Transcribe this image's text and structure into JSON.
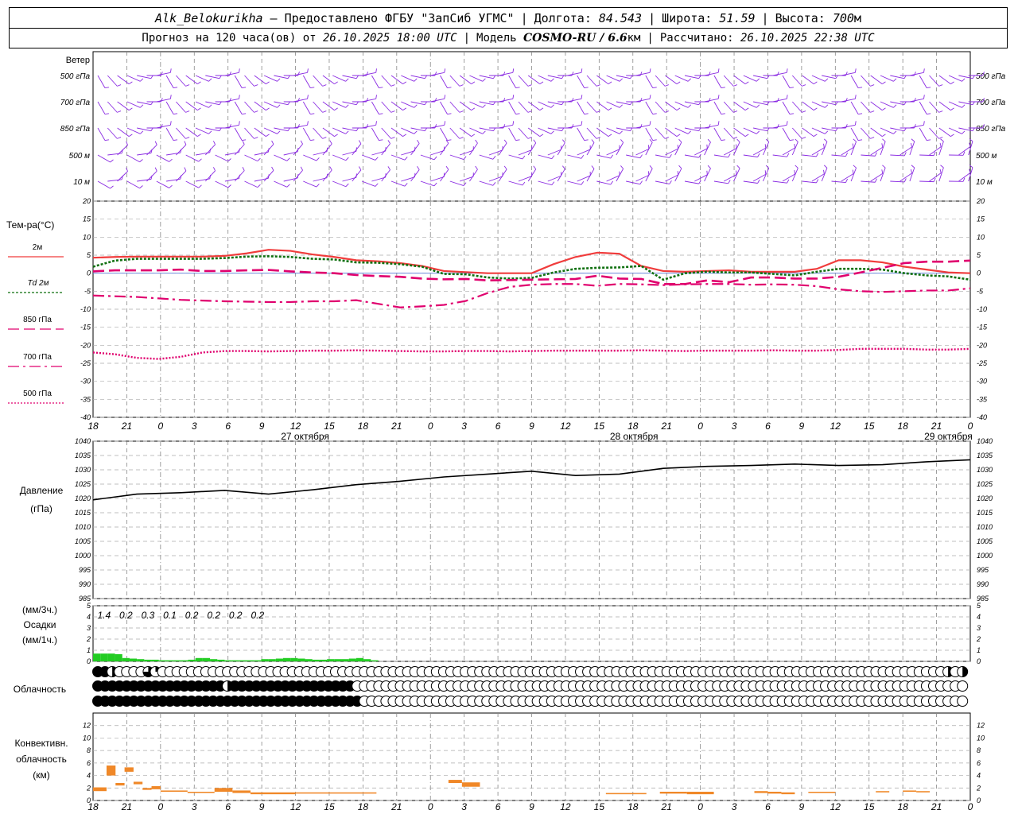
{
  "header": {
    "station": "Alk_Belokurikha",
    "provided": "– Предоставлено ФГБУ \"ЗапСиб УГМС\"",
    "lon_label": "Долгота:",
    "lon": "84.543",
    "lat_label": "Широта:",
    "lat": "51.59",
    "alt_label": "Высота:",
    "alt": "700",
    "alt_unit": "м",
    "fc_label": "Прогноз на 120 часа(ов) от",
    "fc_date": "26.10.2025 18:00 UTC",
    "model_label": "Модель",
    "model": "COSMO-RU / 6.6",
    "model_unit": "км",
    "calc_label": "Рассчитано:",
    "calc_date": "26.10.2025 22:38 UTC"
  },
  "time_ticks": [
    "18",
    "21",
    "0",
    "3",
    "6",
    "9",
    "12",
    "15",
    "18",
    "21",
    "0",
    "3",
    "6",
    "9",
    "12",
    "15",
    "18",
    "21",
    "0",
    "3",
    "6",
    "9",
    "12",
    "15",
    "18",
    "21",
    "0"
  ],
  "date_labels": [
    "27 октября",
    "28 октября",
    "29 октября"
  ],
  "colors": {
    "t2m": "#f03c3c",
    "td": "#107010",
    "t850": "#e0006e",
    "t700": "#e0006e",
    "t500": "#e0006e",
    "wind": "#8a2be2",
    "precip": "#22cc22",
    "conv": "#f08828"
  },
  "chart_data": [
    {
      "type": "wind_barbs",
      "title": "Ветер",
      "levels": [
        "500 гПа",
        "700 гПа",
        "850 гПа",
        "500 м",
        "10  м"
      ]
    },
    {
      "type": "line",
      "title": "Тем-ра(°C)",
      "ylim": [
        -40,
        20
      ],
      "yticks": [
        20,
        15,
        10,
        5,
        0,
        -5,
        -10,
        -15,
        -20,
        -25,
        -30,
        -35,
        -40
      ],
      "x": [
        0,
        3,
        6,
        9,
        12,
        15,
        18,
        21,
        24,
        27,
        30,
        33,
        36,
        39,
        42,
        45,
        48,
        51,
        54,
        57,
        60,
        63,
        66,
        69,
        72,
        75,
        78,
        81,
        84,
        87,
        90,
        93,
        96,
        99,
        102,
        105,
        108,
        111,
        114,
        117,
        120
      ],
      "series": [
        {
          "name": "2м",
          "values": [
            4.3,
            4.5,
            4.6,
            4.6,
            4.6,
            4.6,
            4.8,
            5.5,
            6.5,
            6.2,
            5.2,
            4.5,
            3.6,
            3.3,
            2.8,
            2.0,
            0.6,
            0.3,
            0,
            0,
            0,
            2.5,
            4.5,
            5.7,
            5.4,
            2.0,
            0.6,
            0.4,
            0.6,
            0.8,
            0.4,
            0.4,
            0.4,
            1.2,
            3.6,
            3.6,
            3.0,
            1.8,
            1.0,
            0.2,
            0
          ]
        },
        {
          "name": "Td 2м",
          "values": [
            1.8,
            3.5,
            4.0,
            4.0,
            4.0,
            4.0,
            4.2,
            4.6,
            4.7,
            4.5,
            4.0,
            3.8,
            3.0,
            2.9,
            2.5,
            1.8,
            -0.2,
            -0.3,
            -1.2,
            -1.5,
            -1.3,
            0.2,
            1.2,
            1.5,
            1.6,
            2.0,
            -1.8,
            0,
            0.4,
            0.2,
            0.2,
            -0.2,
            -0.6,
            0.4,
            1.2,
            1.2,
            1.0,
            0,
            -0.6,
            -0.9,
            -1.8
          ]
        },
        {
          "name": "850 гПа",
          "values": [
            0.5,
            0.8,
            0.8,
            0.8,
            1.0,
            0.6,
            0.6,
            0.8,
            0.9,
            0.5,
            0.2,
            0,
            -0.5,
            -0.8,
            -1.0,
            -1.5,
            -1.7,
            -1.6,
            -2.0,
            -1.9,
            -1.8,
            -1.7,
            -1.6,
            -0.7,
            -1.5,
            -1.6,
            -3.0,
            -3.0,
            -2.0,
            -2.5,
            -1.2,
            -1.2,
            -1.5,
            -1.5,
            -1.0,
            0.2,
            1.5,
            2.8,
            3.2,
            3.2,
            3.5
          ]
        },
        {
          "name": "700 гПа",
          "values": [
            -6.2,
            -6.4,
            -6.6,
            -7.0,
            -7.4,
            -7.6,
            -7.8,
            -7.9,
            -8.0,
            -8.0,
            -7.8,
            -7.8,
            -7.5,
            -8.5,
            -9.5,
            -9.2,
            -8.8,
            -7.7,
            -5.5,
            -3.8,
            -3.2,
            -3.0,
            -3.0,
            -3.5,
            -3.0,
            -3.1,
            -3.3,
            -3.1,
            -3.0,
            -3.0,
            -3.2,
            -3.1,
            -3.2,
            -3.6,
            -4.5,
            -5.0,
            -5.2,
            -5.0,
            -4.8,
            -4.8,
            -4.2
          ]
        },
        {
          "name": "500 гПа",
          "values": [
            -22,
            -22.5,
            -23.5,
            -23.8,
            -23.2,
            -22,
            -21.6,
            -21.6,
            -21.7,
            -21.6,
            -21.5,
            -21.5,
            -21.4,
            -21.5,
            -21.6,
            -21.7,
            -21.7,
            -21.6,
            -21.6,
            -21.7,
            -21.6,
            -21.5,
            -21.5,
            -21.5,
            -21.5,
            -21.4,
            -21.5,
            -21.6,
            -21.5,
            -21.5,
            -21.5,
            -21.4,
            -21.5,
            -21.5,
            -21.3,
            -21,
            -21,
            -21,
            -21.2,
            -21.2,
            -21
          ]
        }
      ]
    },
    {
      "type": "line",
      "title": "Давление",
      "ylabel": "(гПа)",
      "ylim": [
        985,
        1040
      ],
      "yticks": [
        1040,
        1035,
        1030,
        1025,
        1020,
        1015,
        1010,
        1005,
        1000,
        995,
        990,
        985
      ],
      "x": [
        0,
        6,
        12,
        18,
        24,
        30,
        36,
        42,
        48,
        54,
        60,
        66,
        72,
        78,
        84,
        90,
        96,
        102,
        108,
        114,
        120
      ],
      "series": [
        {
          "name": "Давление",
          "values": [
            1019.5,
            1021.5,
            1022,
            1022.8,
            1021.5,
            1023,
            1024.8,
            1026,
            1027.5,
            1028.5,
            1029.5,
            1028,
            1028.5,
            1030.5,
            1031.2,
            1031.5,
            1032,
            1031.5,
            1031.8,
            1032.8,
            1033.5
          ]
        }
      ]
    },
    {
      "type": "bar",
      "title": "Осадки",
      "ylabel": "(мм/3ч.)",
      "ylabel2": "(мм/1ч.)",
      "ylim": [
        0,
        5
      ],
      "yticks": [
        5,
        4,
        3,
        2,
        1,
        0
      ],
      "x": [
        0,
        1,
        2,
        3,
        4,
        5,
        6,
        7,
        8,
        9,
        10,
        11,
        12,
        13,
        14,
        15,
        16,
        17,
        18,
        19,
        20,
        21,
        22,
        23,
        24,
        25,
        26,
        27,
        28,
        29,
        30,
        31,
        32,
        33,
        34,
        35,
        36,
        37,
        38
      ],
      "values": [
        0.7,
        0.7,
        0.7,
        0.65,
        0.3,
        0.25,
        0.2,
        0.15,
        0.15,
        0.1,
        0.1,
        0.1,
        0.1,
        0.15,
        0.3,
        0.3,
        0.2,
        0.15,
        0.1,
        0.1,
        0.1,
        0.1,
        0.1,
        0.2,
        0.2,
        0.25,
        0.3,
        0.3,
        0.25,
        0.2,
        0.15,
        0.15,
        0.2,
        0.2,
        0.2,
        0.25,
        0.3,
        0.2,
        0.1
      ],
      "three_hour_totals": [
        {
          "t": 1.5,
          "value": "1.4"
        },
        {
          "t": 4.5,
          "value": "0.2"
        },
        {
          "t": 7.5,
          "value": "0.3"
        },
        {
          "t": 10.5,
          "value": "0.1"
        },
        {
          "t": 13.5,
          "value": "0.2"
        },
        {
          "t": 16.5,
          "value": "0.2"
        },
        {
          "t": 19.5,
          "value": "0.2"
        },
        {
          "t": 22.5,
          "value": "0.2"
        }
      ]
    },
    {
      "type": "cloud_cover",
      "title": "Облачность",
      "rows": [
        [
          4,
          4,
          2,
          0,
          0,
          0,
          0,
          3,
          1,
          0,
          0,
          0,
          0,
          0,
          0,
          0,
          0,
          0,
          0,
          0,
          0,
          0,
          0,
          0,
          0,
          0,
          0,
          0,
          0,
          0,
          0,
          0,
          0,
          0,
          0,
          0,
          0,
          0,
          0,
          0,
          0,
          0,
          0,
          0,
          0,
          0,
          0,
          0,
          0,
          0,
          0,
          0,
          0,
          0,
          0,
          0,
          0,
          0,
          0,
          0,
          0,
          0,
          0,
          0,
          0,
          0,
          0,
          0,
          0,
          0,
          0,
          0,
          0,
          0,
          0,
          0,
          0,
          0,
          0,
          0,
          0,
          0,
          0,
          0,
          0,
          0,
          0,
          0,
          0,
          0,
          0,
          0,
          0,
          0,
          0,
          0,
          0,
          0,
          0,
          0,
          0,
          0,
          0,
          0,
          0,
          0,
          0,
          0,
          0,
          0,
          0,
          0,
          0,
          0,
          0,
          0,
          0,
          0,
          2,
          0,
          2
        ],
        [
          4,
          4,
          4,
          4,
          4,
          4,
          4,
          4,
          4,
          4,
          4,
          4,
          4,
          4,
          4,
          4,
          4,
          4,
          2,
          4,
          4,
          4,
          4,
          4,
          4,
          4,
          4,
          4,
          4,
          4,
          4,
          4,
          4,
          4,
          4,
          4,
          0,
          0,
          0,
          0,
          0,
          0,
          0,
          0,
          0,
          0,
          0,
          0,
          0,
          0,
          0,
          0,
          0,
          0,
          0,
          0,
          0,
          0,
          0,
          0,
          0,
          0,
          0,
          0,
          0,
          0,
          0,
          0,
          0,
          0,
          0,
          0,
          0,
          0,
          0,
          0,
          0,
          0,
          0,
          0,
          0,
          0,
          0,
          0,
          0,
          0,
          0,
          0,
          0,
          0,
          0,
          0,
          0,
          0,
          0,
          0,
          0,
          0,
          0,
          0,
          0,
          0,
          0,
          0,
          0,
          0,
          0,
          0,
          0,
          0,
          0,
          0,
          0,
          0,
          0,
          0,
          0,
          0,
          0,
          0,
          0
        ],
        [
          4,
          4,
          4,
          4,
          4,
          4,
          4,
          4,
          4,
          4,
          4,
          4,
          4,
          4,
          4,
          4,
          4,
          4,
          4,
          4,
          4,
          4,
          4,
          4,
          4,
          4,
          4,
          4,
          4,
          4,
          4,
          4,
          4,
          4,
          4,
          4,
          4,
          0,
          0,
          0,
          0,
          0,
          0,
          0,
          0,
          0,
          0,
          0,
          0,
          0,
          0,
          0,
          0,
          0,
          0,
          0,
          0,
          0,
          0,
          0,
          0,
          0,
          0,
          0,
          0,
          0,
          0,
          0,
          0,
          0,
          0,
          0,
          0,
          0,
          0,
          0,
          0,
          0,
          0,
          0,
          0,
          0,
          0,
          0,
          0,
          0,
          0,
          0,
          0,
          0,
          0,
          0,
          0,
          0,
          0,
          0,
          0,
          0,
          0,
          0,
          0,
          0,
          0,
          0,
          0,
          0,
          0,
          0,
          0,
          0,
          0,
          0,
          0,
          0,
          0,
          0,
          0,
          0,
          0,
          0,
          0
        ]
      ]
    },
    {
      "type": "bar",
      "title": "Конвективн.",
      "subtitle": "облачность",
      "ylabel": "(км)",
      "ylim": [
        0,
        14
      ],
      "yticks": [
        12,
        10,
        8,
        6,
        4,
        2,
        0
      ],
      "segments": [
        {
          "t0": 0,
          "t1": 6,
          "base": 1.5,
          "top": 2.1
        },
        {
          "t0": 6,
          "t1": 10,
          "base": 4.0,
          "top": 5.6
        },
        {
          "t0": 10,
          "t1": 14,
          "base": 2.4,
          "top": 2.8
        },
        {
          "t0": 14,
          "t1": 18,
          "base": 4.6,
          "top": 5.3
        },
        {
          "t0": 18,
          "t1": 22,
          "base": 2.6,
          "top": 3.0
        },
        {
          "t0": 22,
          "t1": 26,
          "base": 1.7,
          "top": 2.0
        },
        {
          "t0": 26,
          "t1": 30,
          "base": 1.8,
          "top": 2.3
        },
        {
          "t0": 30,
          "t1": 42,
          "base": 1.4,
          "top": 1.6
        },
        {
          "t0": 42,
          "t1": 54,
          "base": 1.2,
          "top": 1.4
        },
        {
          "t0": 54,
          "t1": 62,
          "base": 1.4,
          "top": 2.0
        },
        {
          "t0": 62,
          "t1": 70,
          "base": 1.2,
          "top": 1.6
        },
        {
          "t0": 70,
          "t1": 90,
          "base": 1.0,
          "top": 1.3
        },
        {
          "t0": 90,
          "t1": 126,
          "base": 1.1,
          "top": 1.3
        },
        {
          "t0": 158,
          "t1": 164,
          "base": 2.8,
          "top": 3.3
        },
        {
          "t0": 164,
          "t1": 172,
          "base": 2.2,
          "top": 2.9
        },
        {
          "t0": 228,
          "t1": 246,
          "base": 1.0,
          "top": 1.2
        },
        {
          "t0": 252,
          "t1": 264,
          "base": 1.1,
          "top": 1.4
        },
        {
          "t0": 264,
          "t1": 276,
          "base": 1.0,
          "top": 1.4
        },
        {
          "t0": 294,
          "t1": 300,
          "base": 1.2,
          "top": 1.5
        },
        {
          "t0": 300,
          "t1": 306,
          "base": 1.1,
          "top": 1.4
        },
        {
          "t0": 306,
          "t1": 312,
          "base": 1.0,
          "top": 1.3
        },
        {
          "t0": 318,
          "t1": 330,
          "base": 1.2,
          "top": 1.4
        },
        {
          "t0": 348,
          "t1": 354,
          "base": 1.3,
          "top": 1.5
        },
        {
          "t0": 360,
          "t1": 366,
          "base": 1.4,
          "top": 1.6
        },
        {
          "t0": 366,
          "t1": 372,
          "base": 1.3,
          "top": 1.5
        }
      ]
    }
  ]
}
